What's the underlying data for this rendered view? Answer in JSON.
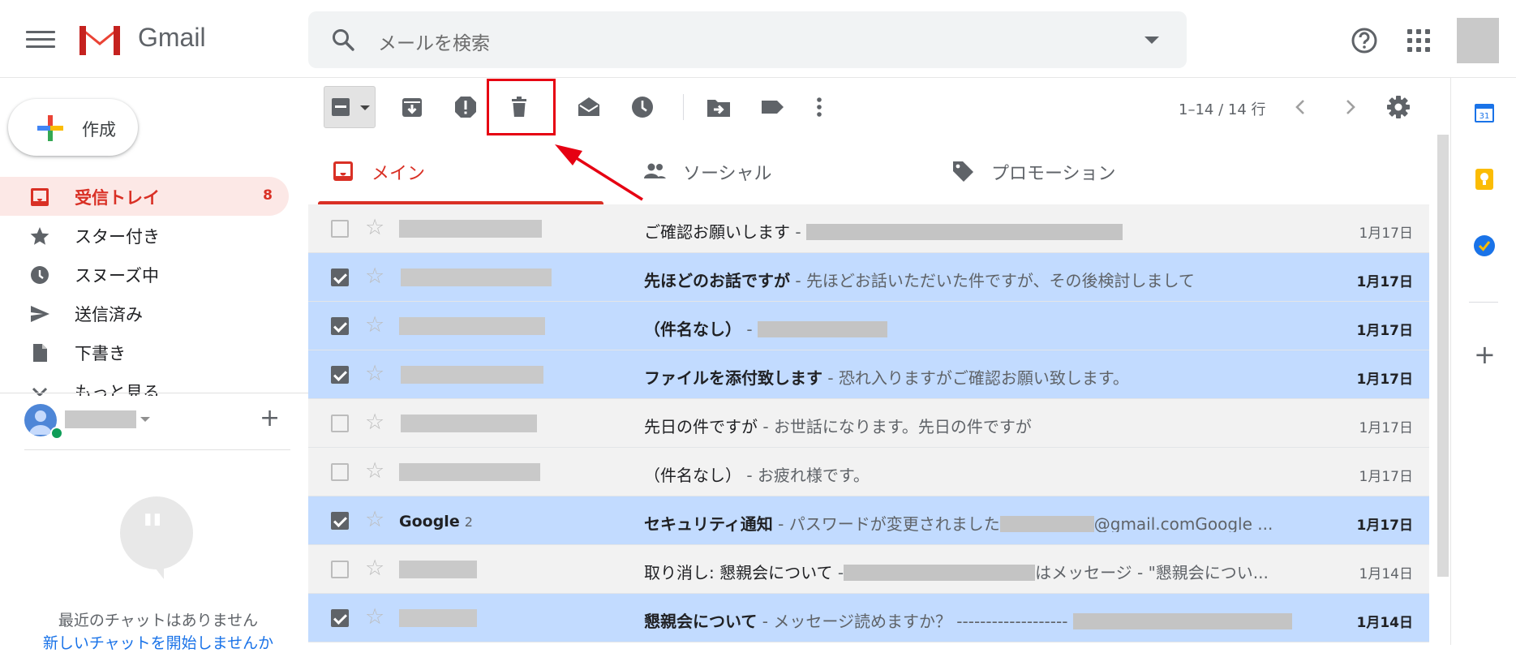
{
  "app": {
    "title": "Gmail"
  },
  "search": {
    "placeholder": "メールを検索"
  },
  "compose": {
    "label": "作成"
  },
  "nav": {
    "items": [
      {
        "label": "受信トレイ",
        "count": "8",
        "icon": "inbox-icon",
        "active": true
      },
      {
        "label": "スター付き",
        "count": "",
        "icon": "star-icon",
        "active": false
      },
      {
        "label": "スヌーズ中",
        "count": "",
        "icon": "clock-icon",
        "active": false
      },
      {
        "label": "送信済み",
        "count": "",
        "icon": "send-icon",
        "active": false
      },
      {
        "label": "下書き",
        "count": "",
        "icon": "draft-icon",
        "active": false
      },
      {
        "label": "もっと見る",
        "count": "",
        "icon": "chevron-down-icon",
        "active": false
      }
    ]
  },
  "hangouts": {
    "no_chats": "最近のチャットはありません",
    "start_chat": "新しいチャットを開始しませんか"
  },
  "toolbar": {
    "page_info": "1–14 / 14 行"
  },
  "tabs": [
    {
      "label": "メイン",
      "icon": "inbox-icon",
      "active": true
    },
    {
      "label": "ソーシャル",
      "icon": "people-icon",
      "active": false
    },
    {
      "label": "プロモーション",
      "icon": "tag-icon",
      "active": false
    }
  ],
  "emails": [
    {
      "selected": false,
      "unread": false,
      "sender": "",
      "sender_count": "",
      "subject": "ご確認お願いします",
      "snippet": "",
      "snippet_after": "",
      "date": "1月17日"
    },
    {
      "selected": true,
      "unread": true,
      "sender": "",
      "sender_count": "",
      "subject": "先ほどのお話ですが",
      "snippet": "先ほどお話いただいた件ですが、その後検討しまして",
      "snippet_after": "",
      "date": "1月17日"
    },
    {
      "selected": true,
      "unread": true,
      "sender": "",
      "sender_count": "",
      "subject": "（件名なし）",
      "snippet": "",
      "snippet_after": "",
      "date": "1月17日"
    },
    {
      "selected": true,
      "unread": true,
      "sender": "",
      "sender_count": "",
      "subject": "ファイルを添付致します",
      "snippet": "恐れ入りますがご確認お願い致します。",
      "snippet_after": "",
      "date": "1月17日"
    },
    {
      "selected": false,
      "unread": false,
      "sender": "",
      "sender_count": "",
      "subject": "先日の件ですが",
      "snippet": "お世話になります。先日の件ですが",
      "snippet_after": "",
      "date": "1月17日"
    },
    {
      "selected": false,
      "unread": false,
      "sender": "",
      "sender_count": "",
      "subject": "（件名なし）",
      "snippet": "お疲れ様です。",
      "snippet_after": "",
      "date": "1月17日"
    },
    {
      "selected": true,
      "unread": true,
      "sender": "Google",
      "sender_count": "2",
      "subject": "セキュリティ通知",
      "snippet": "パスワードが変更されました",
      "snippet_after": "@gmail.comGoogle ...",
      "date": "1月17日"
    },
    {
      "selected": false,
      "unread": false,
      "sender": "",
      "sender_count": "",
      "subject": "取り消し: 懇親会について",
      "snippet": "",
      "snippet_after": "はメッセージ - \"懇親会につい...",
      "date": "1月14日"
    },
    {
      "selected": true,
      "unread": true,
      "sender": "",
      "sender_count": "",
      "subject": "懇親会について",
      "snippet": "メッセージ読めますか？ -------------------",
      "snippet_after": "",
      "date": "1月14日"
    }
  ],
  "colors": {
    "accent_red": "#d93025",
    "selected_row": "#c2dbff",
    "annotation_red": "#e60012"
  }
}
